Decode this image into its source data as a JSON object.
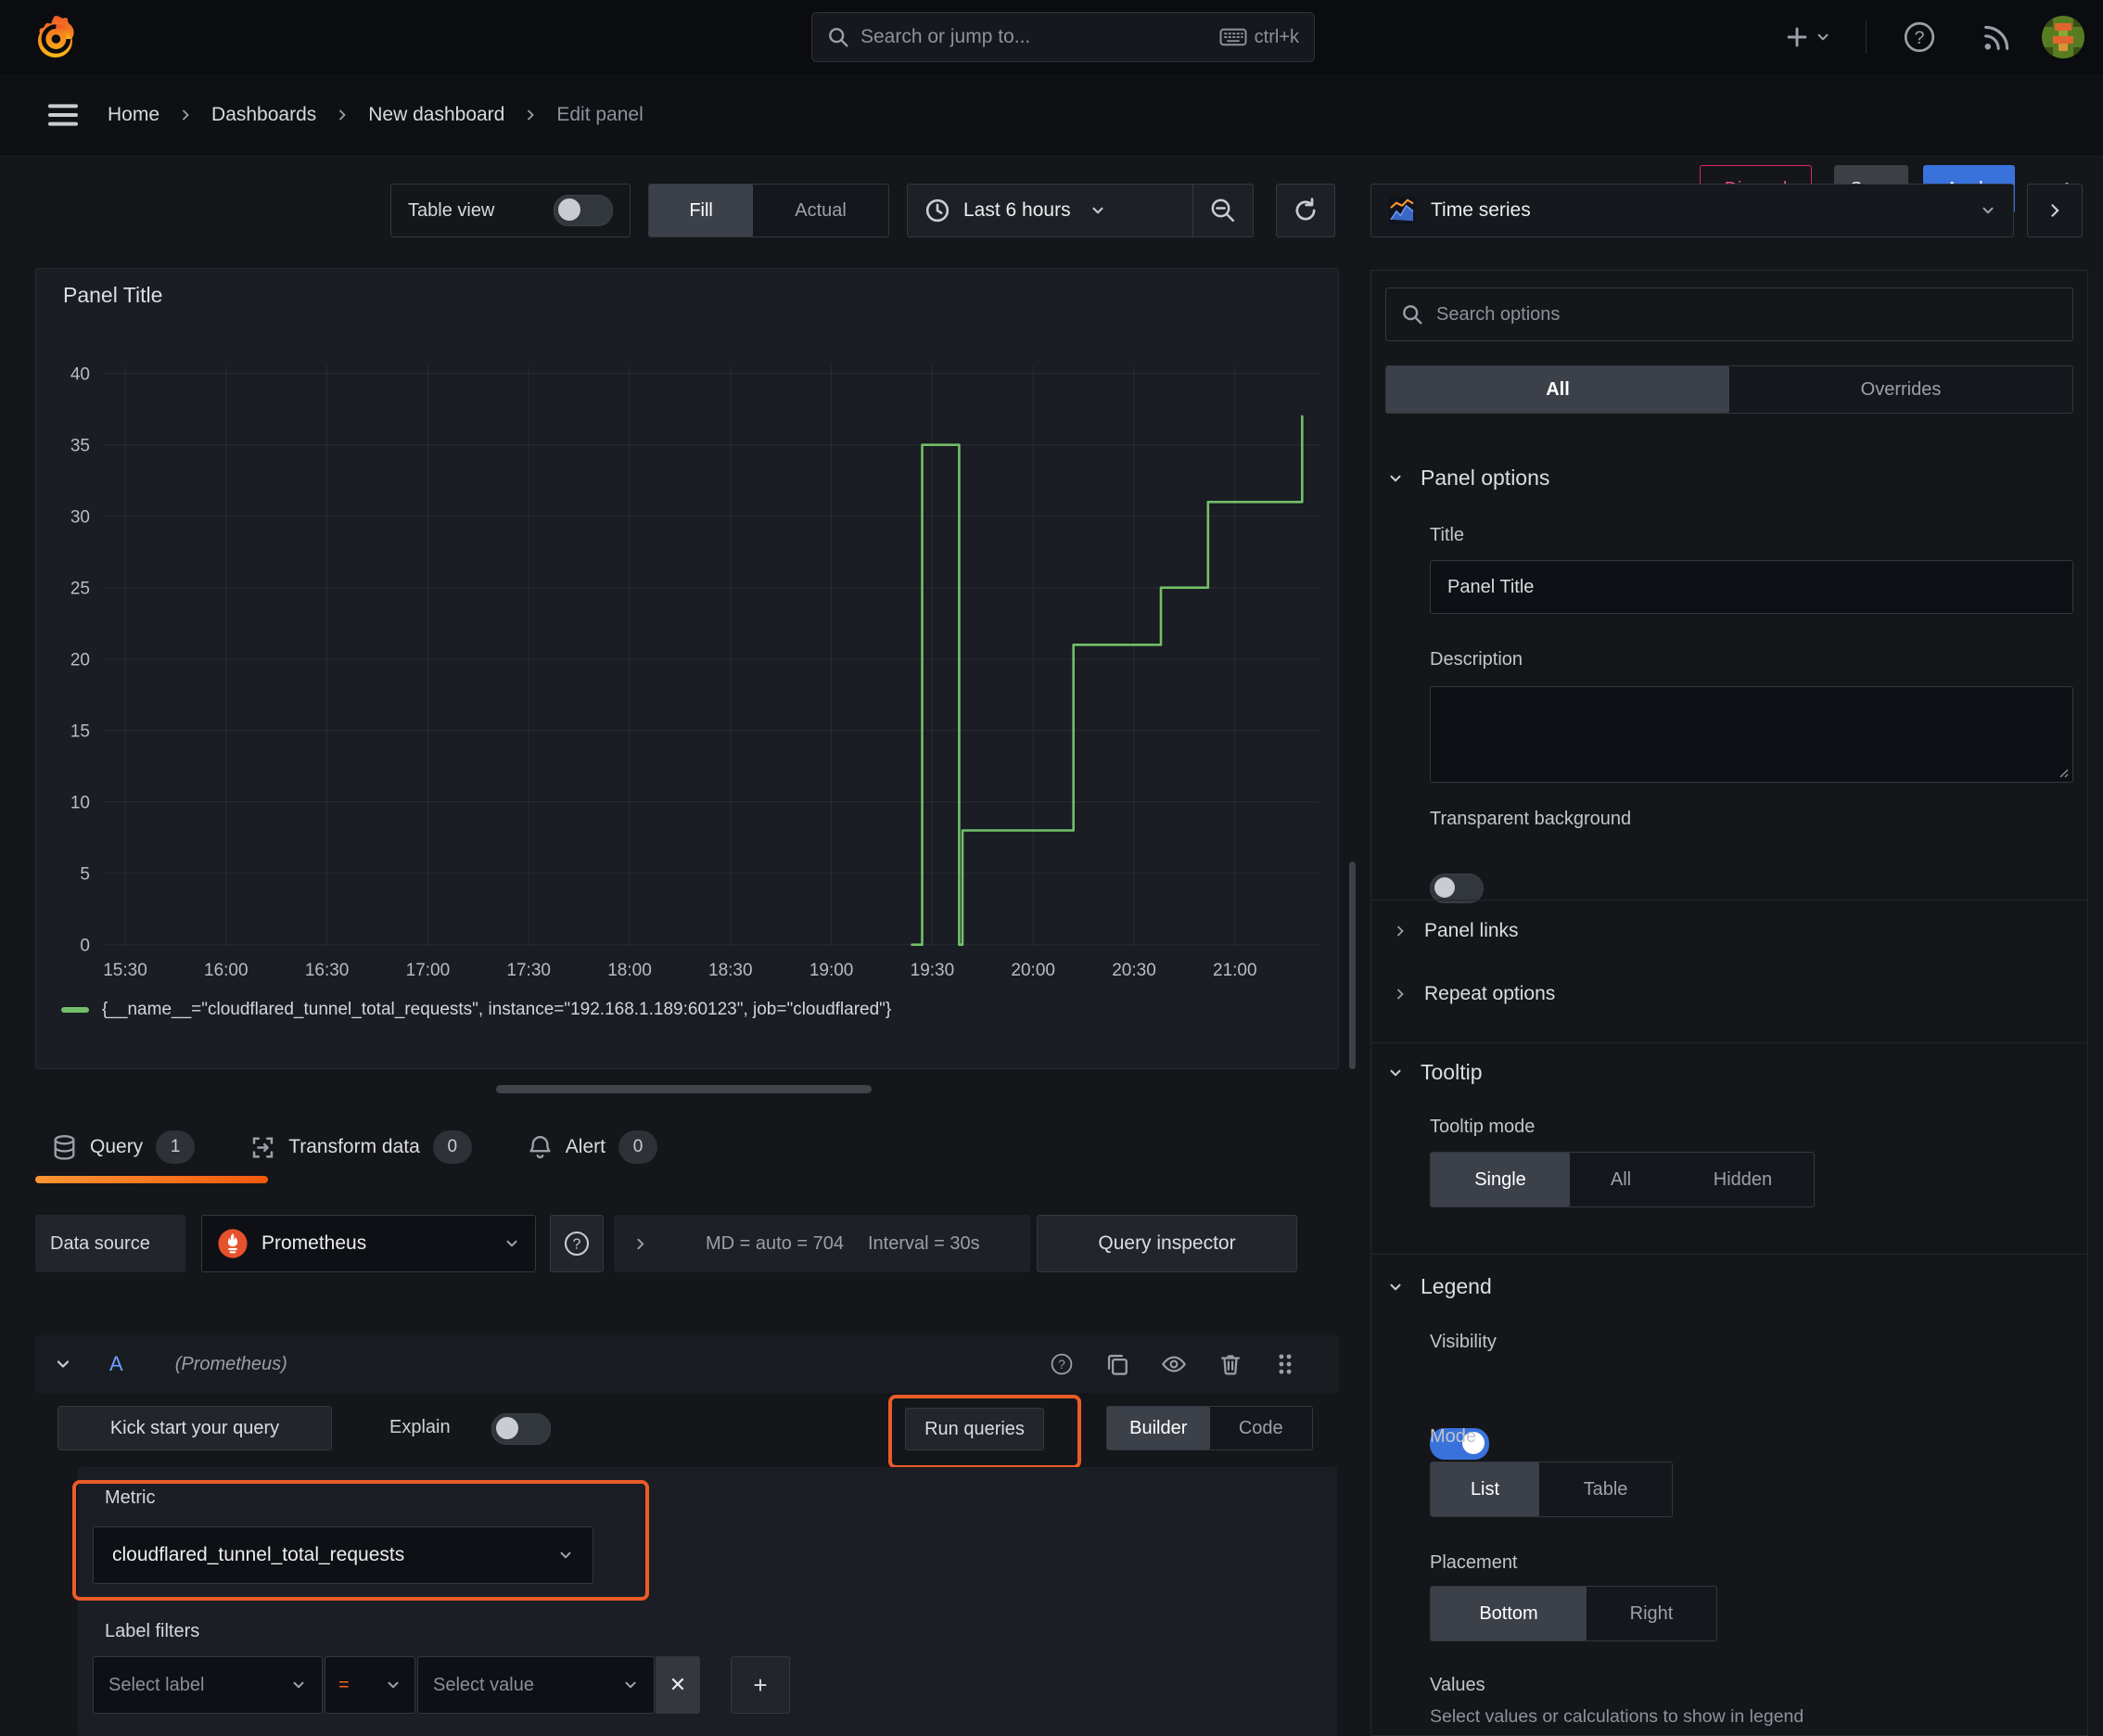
{
  "topnav": {
    "search_placeholder": "Search or jump to...",
    "search_shortcut": "ctrl+k"
  },
  "breadcrumb": {
    "items": [
      {
        "label": "Home"
      },
      {
        "label": "Dashboards"
      },
      {
        "label": "New dashboard"
      },
      {
        "label": "Edit panel"
      }
    ],
    "discard": "Discard",
    "save": "Save",
    "apply": "Apply"
  },
  "toolbar": {
    "table_view": "Table view",
    "fill": "Fill",
    "actual": "Actual",
    "time_range": "Last 6 hours"
  },
  "chart_data": {
    "type": "line",
    "step": true,
    "title": "Panel Title",
    "x_ticks": [
      "15:30",
      "16:00",
      "16:30",
      "17:00",
      "17:30",
      "18:00",
      "18:30",
      "19:00",
      "19:30",
      "20:00",
      "20:30",
      "21:00"
    ],
    "y_ticks": [
      0,
      5,
      10,
      15,
      20,
      25,
      30,
      35,
      40
    ],
    "ylim": [
      0,
      40
    ],
    "grid": true,
    "legend_position": "bottom",
    "series": [
      {
        "name": "{__name__=\"cloudflared_tunnel_total_requests\", instance=\"192.168.1.189:60123\", job=\"cloudflared\"}",
        "color": "#73bf69",
        "points": [
          [
            "19:24",
            0
          ],
          [
            "19:27",
            0
          ],
          [
            "19:27",
            35
          ],
          [
            "19:38",
            35
          ],
          [
            "19:38",
            0
          ],
          [
            "19:39",
            0
          ],
          [
            "19:39",
            8
          ],
          [
            "20:12",
            8
          ],
          [
            "20:12",
            21
          ],
          [
            "20:38",
            21
          ],
          [
            "20:38",
            25
          ],
          [
            "20:52",
            25
          ],
          [
            "20:52",
            31
          ],
          [
            "21:20",
            31
          ],
          [
            "21:20",
            37
          ]
        ]
      }
    ]
  },
  "tabs": {
    "query": "Query",
    "query_count": "1",
    "transform": "Transform data",
    "transform_count": "0",
    "alert": "Alert",
    "alert_count": "0"
  },
  "datasource": {
    "label": "Data source",
    "name": "Prometheus",
    "stats_md": "MD = auto = 704",
    "stats_interval": "Interval = 30s",
    "query_inspector": "Query inspector"
  },
  "query_row": {
    "ref_id": "A",
    "ds_hint": "(Prometheus)"
  },
  "query_toolbar": {
    "kick_start": "Kick start your query",
    "explain": "Explain",
    "run_queries": "Run queries",
    "builder": "Builder",
    "code": "Code"
  },
  "editor": {
    "metric_label": "Metric",
    "metric_value": "cloudflared_tunnel_total_requests",
    "label_filters": "Label filters",
    "select_label": "Select label",
    "op": "=",
    "select_value": "Select value"
  },
  "sidebar": {
    "visualization": "Time series",
    "search_placeholder": "Search options",
    "tab_all": "All",
    "tab_overrides": "Overrides",
    "panel_options": {
      "title": "Panel options",
      "title_label": "Title",
      "title_value": "Panel Title",
      "description_label": "Description",
      "transparent": "Transparent background"
    },
    "links": "Panel links",
    "repeat": "Repeat options",
    "tooltip": {
      "title": "Tooltip",
      "mode_label": "Tooltip mode",
      "options": [
        "Single",
        "All",
        "Hidden"
      ],
      "selected": "Single"
    },
    "legend": {
      "title": "Legend",
      "visibility": "Visibility",
      "mode_label": "Mode",
      "mode_options": [
        "List",
        "Table"
      ],
      "mode_selected": "List",
      "placement_label": "Placement",
      "placement_options": [
        "Bottom",
        "Right"
      ],
      "placement_selected": "Bottom",
      "values_label": "Values",
      "values_hint": "Select values or calculations to show in legend"
    }
  },
  "colors": {
    "accent_blue": "#3a72dc",
    "annotation_orange": "#eb5b28",
    "tab_underline_orange": "#ff780a",
    "series_green": "#73bf69",
    "discard_pink": "#e0246e",
    "ref_id_blue": "#6e9fff",
    "prometheus_orange": "#e6522c"
  }
}
